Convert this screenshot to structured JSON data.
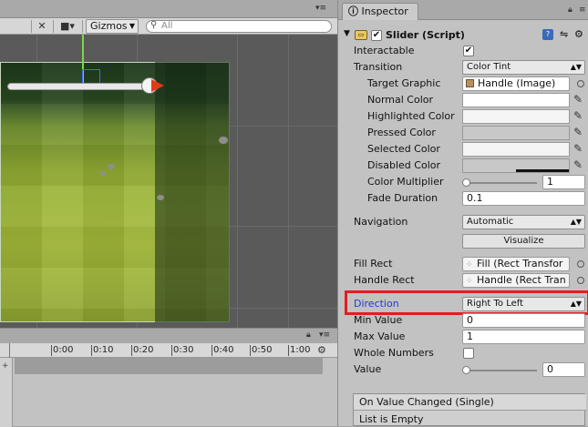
{
  "scene": {
    "gizmos_label": "Gizmos",
    "search_placeholder": "All"
  },
  "timeline": {
    "ticks": [
      "0:00",
      "0:10",
      "0:20",
      "0:30",
      "0:40",
      "0:50",
      "1:00"
    ]
  },
  "inspector": {
    "tab_label": "Inspector",
    "component": {
      "title": "Slider (Script)",
      "enabled": true
    },
    "rows": {
      "interactable": {
        "label": "Interactable",
        "checked": true
      },
      "transition": {
        "label": "Transition",
        "value": "Color Tint"
      },
      "target_graphic": {
        "label": "Target Graphic",
        "value": "Handle (Image)"
      },
      "normal_color": {
        "label": "Normal Color",
        "color": "#ffffff"
      },
      "highlighted_color": {
        "label": "Highlighted Color",
        "color": "#f5f5f5"
      },
      "pressed_color": {
        "label": "Pressed Color",
        "color": "#c8c8c8"
      },
      "selected_color": {
        "label": "Selected Color",
        "color": "#f5f5f5"
      },
      "disabled_color": {
        "label": "Disabled Color",
        "color": "#c8c8c8"
      },
      "color_multiplier": {
        "label": "Color Multiplier",
        "value": "1",
        "level": 0
      },
      "fade_duration": {
        "label": "Fade Duration",
        "value": "0.1"
      },
      "navigation": {
        "label": "Navigation",
        "value": "Automatic"
      },
      "visualize": {
        "label": "Visualize"
      },
      "fill_rect": {
        "label": "Fill Rect",
        "value": "Fill (Rect Transfor"
      },
      "handle_rect": {
        "label": "Handle Rect",
        "value": "Handle (Rect Tran"
      },
      "direction": {
        "label": "Direction",
        "value": "Right To Left"
      },
      "min_value": {
        "label": "Min Value",
        "value": "0"
      },
      "max_value": {
        "label": "Max Value",
        "value": "1"
      },
      "whole_numbers": {
        "label": "Whole Numbers",
        "checked": false
      },
      "value": {
        "label": "Value",
        "value": "0",
        "level": 0
      }
    },
    "event": {
      "title": "On Value Changed (Single)",
      "empty_text": "List is Empty"
    }
  }
}
